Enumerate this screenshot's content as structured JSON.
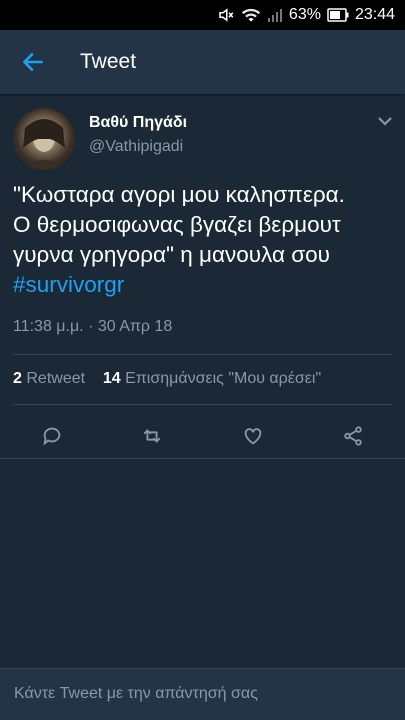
{
  "status_bar": {
    "battery": "63%",
    "time": "23:44",
    "icons": [
      "mute-icon",
      "wifi-icon",
      "signal-icon",
      "battery-icon"
    ]
  },
  "app_bar": {
    "title": "Tweet"
  },
  "tweet": {
    "display_name": "Βαθύ Πηγάδι",
    "handle": "@Vathipigadi",
    "text_lines": [
      "\"Κωσταρα αγορι μου καλησπερα.",
      "Ο θερμοσιφωνας βγαζει βερμουτ",
      "γυρνα γρηγορα\" η μανουλα σου"
    ],
    "hashtag": "#survivorgr",
    "timestamp": "11:38 μ.μ. · 30 Απρ 18",
    "retweets": {
      "count": "2",
      "label": "Retweet"
    },
    "likes": {
      "count": "14",
      "label": "Επισημάνσεις \"Μου αρέσει\""
    }
  },
  "reply": {
    "placeholder": "Κάντε Tweet με την απάντησή σας"
  },
  "colors": {
    "background": "#1b2836",
    "bar": "#243447",
    "accent": "#1da1f2",
    "muted": "#8899a6"
  }
}
